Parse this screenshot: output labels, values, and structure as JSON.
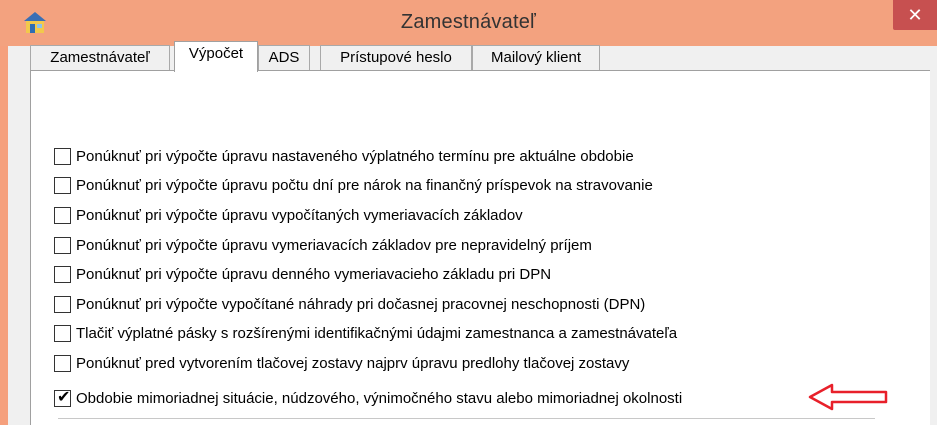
{
  "window": {
    "title": "Zamestnávateľ",
    "close_glyph": "✕"
  },
  "tabs": [
    {
      "label": "Zamestnávateľ",
      "active": false
    },
    {
      "label": "Výpočet",
      "active": true
    },
    {
      "label": "ADS",
      "active": false
    },
    {
      "label": "Prístupové heslo",
      "active": false
    },
    {
      "label": "Mailový klient",
      "active": false
    }
  ],
  "options": [
    {
      "label": "Ponúknuť pri výpočte úpravu nastaveného výplatného termínu pre aktuálne obdobie",
      "checked": false
    },
    {
      "label": "Ponúknuť pri výpočte úpravu počtu dní pre nárok na finančný príspevok na stravovanie",
      "checked": false
    },
    {
      "label": "Ponúknuť pri výpočte úpravu vypočítaných vymeriavacích základov",
      "checked": false
    },
    {
      "label": "Ponúknuť pri výpočte úpravu vymeriavacích základov pre nepravidelný príjem",
      "checked": false
    },
    {
      "label": "Ponúknuť pri výpočte úpravu denného vymeriavacieho základu pri DPN",
      "checked": false
    },
    {
      "label": "Ponúknuť pri výpočte vypočítané náhrady pri dočasnej pracovnej neschopnosti (DPN)",
      "checked": false
    },
    {
      "label": "Tlačiť výplatné pásky s rozšírenými identifikačnými údajmi zamestnanca a zamestnávateľa",
      "checked": false
    },
    {
      "label": "Ponúknuť pred vytvorením tlačovej zostavy najprv úpravu predlohy tlačovej zostavy",
      "checked": false
    },
    {
      "label": "Obdobie mimoriadnej situácie, núdzového, výnimočného stavu alebo mimoriadnej okolnosti",
      "checked": true
    }
  ],
  "annotation": {
    "arrow_color": "#e8202a",
    "icon": "left-arrow-icon"
  },
  "icons": {
    "app": "app-icon",
    "check": "checkmark-icon"
  }
}
